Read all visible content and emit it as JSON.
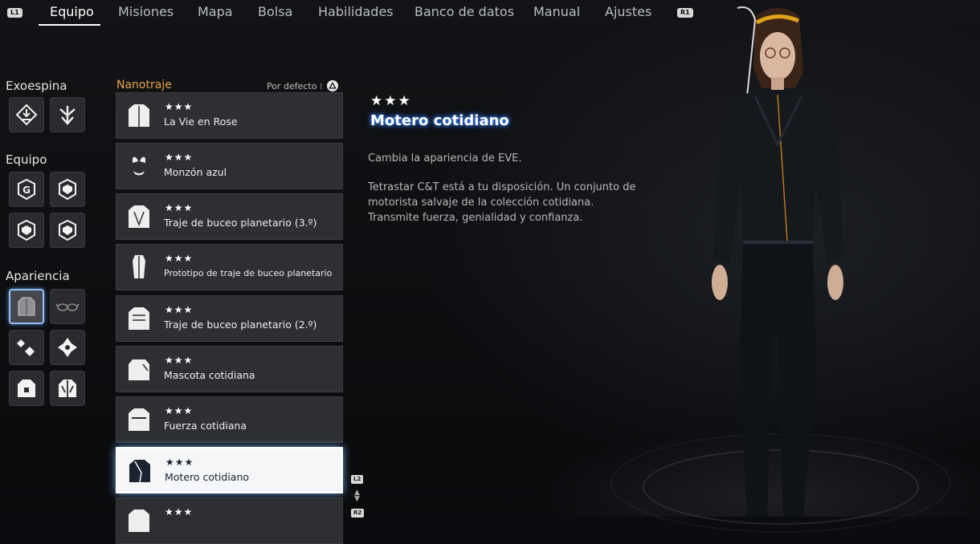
{
  "nav": {
    "left_hint": "L1",
    "right_hint": "R1",
    "tabs": [
      "Equipo",
      "Misiones",
      "Mapa",
      "Bolsa",
      "Habilidades",
      "Banco de datos",
      "Manual",
      "Ajustes"
    ]
  },
  "categories": {
    "exospine": "Exoespina",
    "gear": "Equipo",
    "appearance": "Apariencia"
  },
  "list": {
    "title": "Nanotraje",
    "sort_label": "Por defecto",
    "items": [
      {
        "stars": "★★★",
        "name": "La Vie en Rose"
      },
      {
        "stars": "★★★",
        "name": "Monzón azul"
      },
      {
        "stars": "★★★",
        "name": "Traje de buceo planetario (3.º)"
      },
      {
        "stars": "★★★",
        "name": "Prototipo de traje de buceo planetario"
      },
      {
        "stars": "★★★",
        "name": "Traje de buceo planetario (2.º)"
      },
      {
        "stars": "★★★",
        "name": "Mascota cotidiana"
      },
      {
        "stars": "★★★",
        "name": "Fuerza cotidiana"
      },
      {
        "stars": "★★★",
        "name": "Motero cotidiano"
      },
      {
        "stars": "★★★",
        "name": ""
      }
    ],
    "scroll_up_hint": "L2",
    "scroll_down_hint": "R2"
  },
  "detail": {
    "stars": "★★★",
    "name": "Motero cotidiano",
    "line1": "Cambia la apariencia de EVE.",
    "line2": "Tetrastar C&T está a tu disposición. Un conjunto de",
    "line3": "motorista salvaje de la colección cotidiana.",
    "line4": "Transmite fuerza, genialidad y confianza."
  },
  "colors": {
    "accent_orange": "#e6a24a",
    "selection_glow": "#8fc0ff",
    "title_glow": "#3b8cff"
  }
}
